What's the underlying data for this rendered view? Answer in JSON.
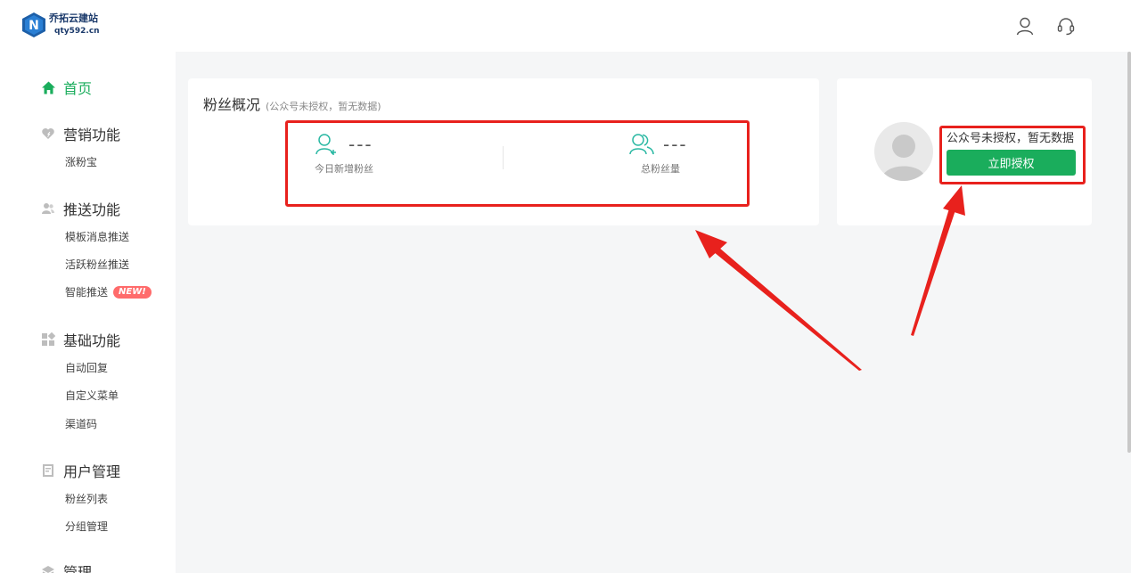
{
  "header": {
    "logo_name": "乔拓云建站",
    "logo_domain": "qty592.cn",
    "icons": [
      "user-icon",
      "headset-icon"
    ]
  },
  "sidebar": {
    "home_label": "首页",
    "groups": [
      {
        "title": "营销功能",
        "icon": "heart-icon",
        "items": [
          "涨粉宝"
        ]
      },
      {
        "title": "推送功能",
        "icon": "people-icon",
        "items": [
          "模板消息推送",
          "活跃粉丝推送",
          "智能推送"
        ]
      },
      {
        "title": "基础功能",
        "icon": "grid-icon",
        "items": [
          "自动回复",
          "自定义菜单",
          "渠道码"
        ]
      },
      {
        "title": "用户管理",
        "icon": "book-icon",
        "items": [
          "粉丝列表",
          "分组管理"
        ]
      },
      {
        "title": "管理",
        "icon": "layers-icon",
        "items": []
      }
    ],
    "new_badge": "NEW!"
  },
  "fans_card": {
    "title": "粉丝概况",
    "subtitle": "(公众号未授权，暂无数据)",
    "stats": [
      {
        "value": "---",
        "label": "今日新增粉丝"
      },
      {
        "value": "---",
        "label": "总粉丝量"
      }
    ]
  },
  "auth_card": {
    "text": "公众号未授权，暂无数据",
    "button_label": "立即授权"
  },
  "colors": {
    "brand_green": "#1aad5c",
    "stat_teal": "#2ab8a3",
    "annotation_red": "#e8211d",
    "badge_red": "#ff6b6b"
  }
}
